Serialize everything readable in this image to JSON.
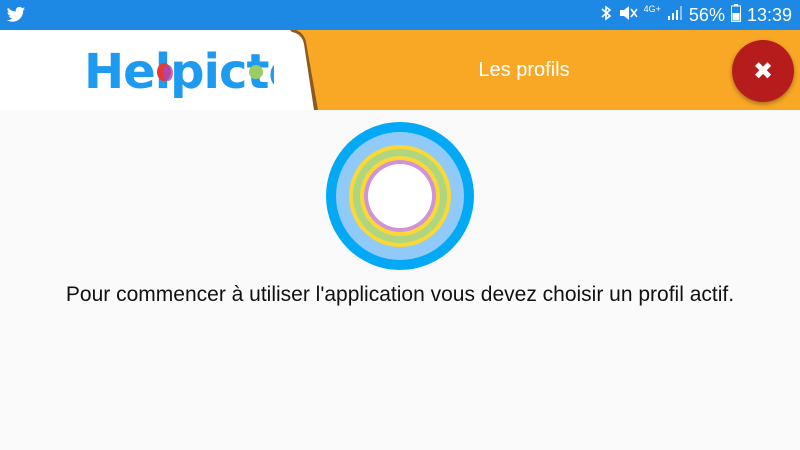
{
  "status_bar": {
    "app_icon": "twitter-bird-icon",
    "icons": [
      "bluetooth-icon",
      "mute-icon",
      "network-4g-icon",
      "signal-icon"
    ],
    "network_label": "4G+",
    "battery_percent": "56%",
    "time": "13:39"
  },
  "header": {
    "logo_text": "Helpicto",
    "title": "Les profils",
    "close_icon": "close-icon",
    "colors": {
      "orange": "#f9a825",
      "close": "#b71c1c",
      "logo": "#1e9bf0"
    }
  },
  "main": {
    "illustration": "profile-rings-icon",
    "message": "Pour commencer à utiliser l'application vous devez choisir un profil actif."
  }
}
